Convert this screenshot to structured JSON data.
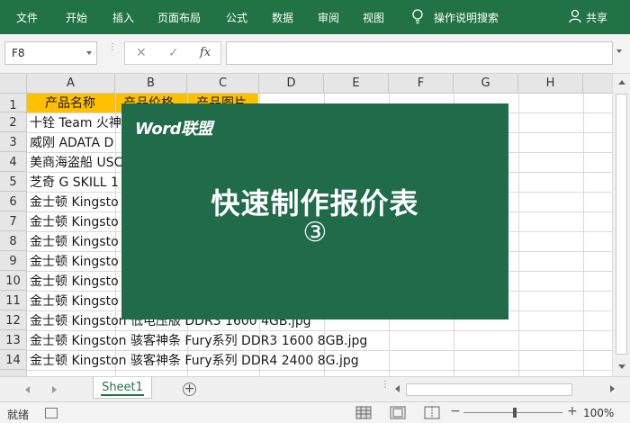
{
  "ribbon": {
    "tabs": [
      "文件",
      "开始",
      "插入",
      "页面布局",
      "公式",
      "数据",
      "审阅",
      "视图"
    ],
    "tell_me": "操作说明搜索",
    "share": "共享"
  },
  "formula_bar": {
    "name_box": "F8",
    "cancel_icon": "✕",
    "enter_icon": "✓",
    "fx_label": "fx",
    "value": ""
  },
  "grid": {
    "columns": [
      "A",
      "B",
      "C",
      "D",
      "E",
      "F",
      "G",
      "H"
    ],
    "rows": [
      "1",
      "2",
      "3",
      "4",
      "5",
      "6",
      "7",
      "8",
      "9",
      "10",
      "11",
      "12",
      "13",
      "14"
    ],
    "header_row": [
      "产品名称",
      "产品价格",
      "产品图片"
    ],
    "cells": [
      "十铨 Team 火神",
      "威刚 ADATA D",
      "美商海盗船 USC",
      "芝奇 G SKILL 1",
      "金士顿 Kingsto",
      "金士顿 Kingsto",
      "金士顿 Kingsto",
      "金士顿 Kingsto",
      "金士顿 Kingsto",
      "金士顿 Kingsto",
      "金士顿 Kingston 低电压版 DDR3 1600 4GB.jpg",
      "金士顿 Kingston 骇客神条 Fury系列 DDR3 1600 8GB.jpg",
      "金士顿 Kingston 骇客神条 Fury系列 DDR4 2400 8G.jpg"
    ]
  },
  "sheet_tabs": {
    "active": "Sheet1",
    "add_icon": "+"
  },
  "status_bar": {
    "ready": "就绪",
    "zoom_minus": "−",
    "zoom_plus": "+",
    "zoom": "100%"
  },
  "banner": {
    "logo": "Word联盟",
    "title": "快速制作报价表",
    "number": "③",
    "background": "#1f6b4a"
  },
  "colors": {
    "ribbon": "#217346",
    "header_fill": "#ffc000"
  }
}
